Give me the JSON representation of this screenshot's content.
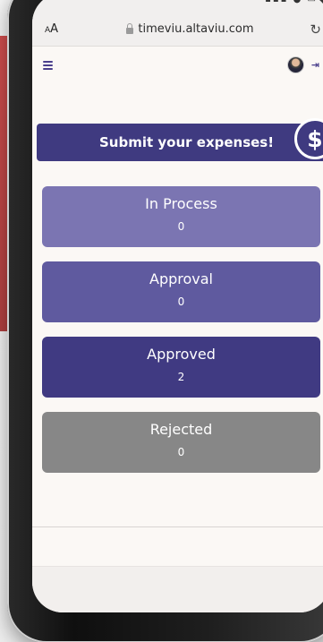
{
  "browser": {
    "text_size_label": "AA",
    "url": "timeviu.altaviu.com",
    "reload_icon": "reload-icon"
  },
  "header": {
    "menu_icon": "hamburger-menu-icon",
    "avatar_icon": "user-avatar",
    "logout_icon": "logout-icon"
  },
  "banner": {
    "label": "Submit your expenses!",
    "badge_symbol": "$"
  },
  "cards": [
    {
      "label": "In Process",
      "count": "0",
      "color": "#7b75b2"
    },
    {
      "label": "Approval",
      "count": "0",
      "color": "#5f5a9f"
    },
    {
      "label": "Approved",
      "count": "2",
      "color": "#403a82"
    },
    {
      "label": "Rejected",
      "count": "0",
      "color": "#878787"
    }
  ],
  "colors": {
    "primary": "#403a82",
    "background": "#fbf8f5",
    "rejected": "#878787"
  }
}
